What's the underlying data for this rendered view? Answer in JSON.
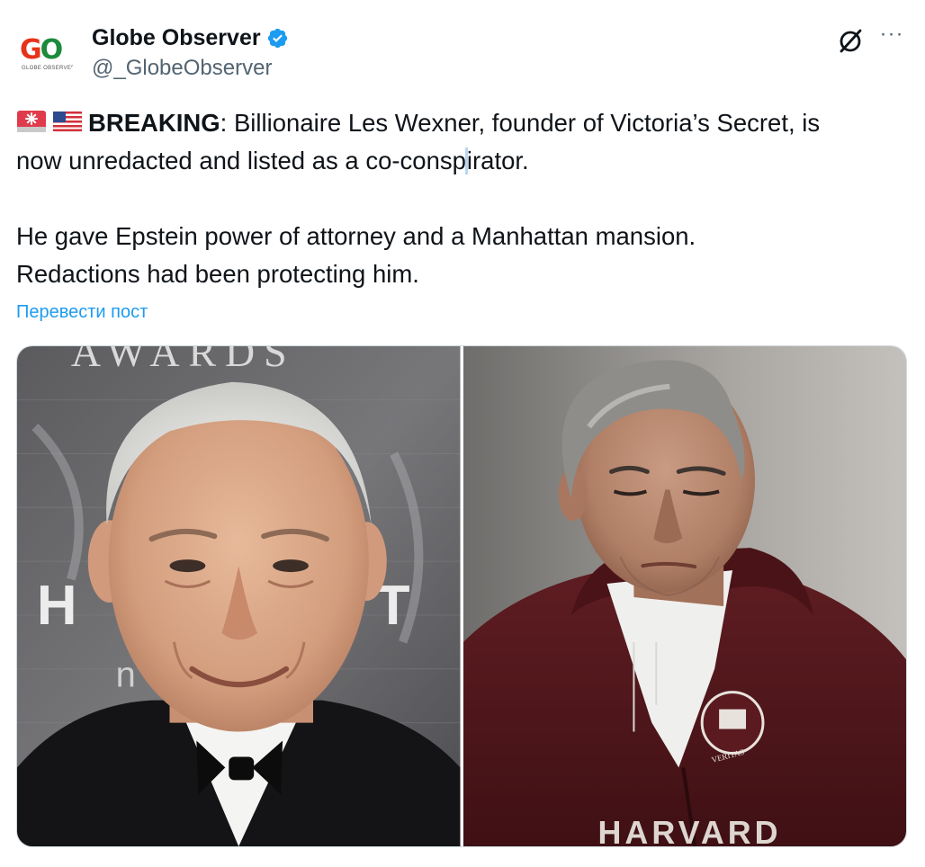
{
  "author": {
    "display_name": "Globe Observer",
    "handle": "@_GlobeObserver",
    "verified": true,
    "avatar": {
      "logo_text_g": "G",
      "logo_text_o": "O",
      "tagline": "GLOBE OBSERVER"
    }
  },
  "actions": {
    "grok_icon": "grok-icon",
    "more_icon": "more-icon",
    "more_label": "···"
  },
  "tweet": {
    "emoji_1": "rotating-light-emoji",
    "emoji_2": "us-flag-emoji",
    "breaking": "BREAKING",
    "line1_rest": ": Billionaire Les Wexner, founder of Victoria’s Secret, is",
    "line2_pre": "now unredacted and listed as a co-consp",
    "line2_post": "irator.",
    "para2_line1": "He gave Epstein power of attorney and a Manhattan mansion.",
    "para2_line2": "Redactions had been protecting him."
  },
  "translate_label": "Перевести пост",
  "media": {
    "left_photo": "photo-older-man-tuxedo",
    "left_backdrop_text": "AWARDS",
    "left_backdrop_letters": [
      "H",
      "T",
      "n"
    ],
    "right_photo": "photo-man-maroon-hoodie",
    "right_hoodie_text": "HARVARD",
    "right_badge_text": "VERITAS"
  },
  "colors": {
    "accent": "#1d9bf0",
    "verified": "#1d9bf0",
    "text": "#0f1419",
    "secondary": "#536471"
  }
}
